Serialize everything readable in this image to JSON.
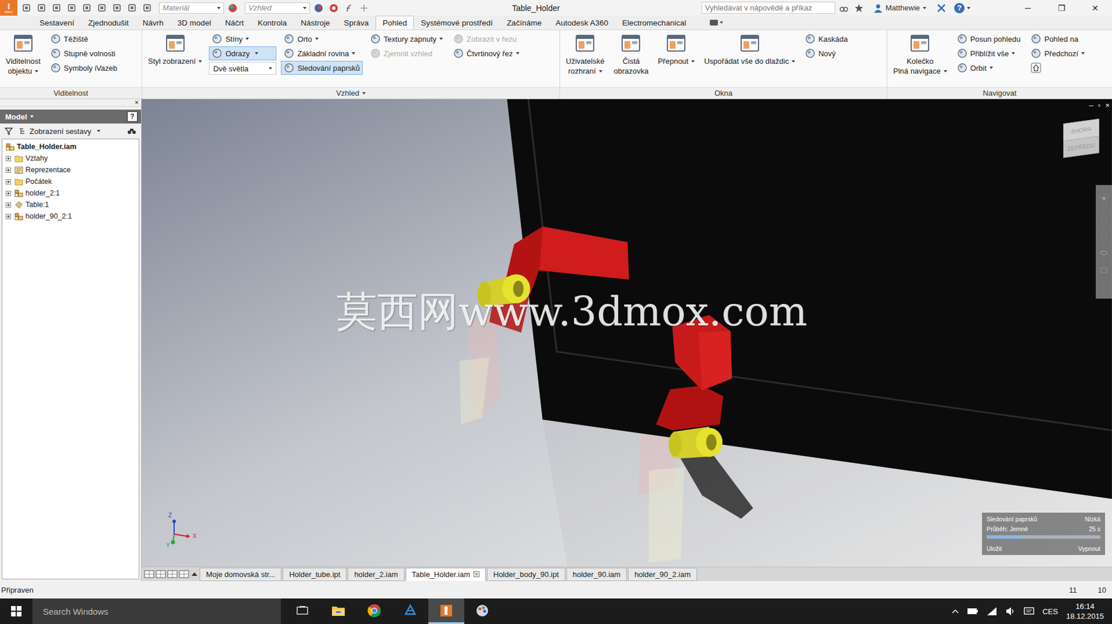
{
  "window": {
    "title": "Table_Holder",
    "controls": [
      "─",
      "❐",
      "✕"
    ]
  },
  "titlebar": {
    "logo": "I",
    "edition": "PRO",
    "material": "Materiál",
    "appearance": "Vzhled",
    "search_placeholder": "Vyhledávat v nápovědě a příkaz",
    "user": "Matthewie",
    "help": "?"
  },
  "ribbon": {
    "tabs": [
      {
        "label": "Sestavení",
        "selected": false
      },
      {
        "label": "Zjednodušit",
        "selected": false
      },
      {
        "label": "Návrh",
        "selected": false
      },
      {
        "label": "3D model",
        "selected": false
      },
      {
        "label": "Náčrt",
        "selected": false
      },
      {
        "label": "Kontrola",
        "selected": false
      },
      {
        "label": "Nástroje",
        "selected": false
      },
      {
        "label": "Správa",
        "selected": false
      },
      {
        "label": "Pohled",
        "selected": true
      },
      {
        "label": "Systémové prostředí",
        "selected": false
      },
      {
        "label": "Začínáme",
        "selected": false
      },
      {
        "label": "Autodesk A360",
        "selected": false
      },
      {
        "label": "Electromechanical",
        "selected": false
      }
    ],
    "groups": [
      {
        "label": "Viditelnost",
        "menu": false,
        "columns": [
          [
            {
              "kind": "large",
              "lines": [
                "Viditelnost",
                "objektu"
              ],
              "menu": true,
              "selected": false,
              "disabled": false
            }
          ],
          [
            {
              "kind": "small",
              "label": "Těžiště",
              "menu": false,
              "selected": false,
              "disabled": false
            },
            {
              "kind": "small",
              "label": "Stupně volnosti",
              "menu": false,
              "selected": false,
              "disabled": false
            },
            {
              "kind": "small",
              "label": "Symboly iVazeb",
              "menu": false,
              "selected": false,
              "disabled": false
            }
          ]
        ]
      },
      {
        "label": "Vzhled",
        "menu": true,
        "columns": [
          [
            {
              "kind": "large",
              "lines": [
                "Styl zobrazení"
              ],
              "menu": true,
              "selected": false,
              "disabled": false
            }
          ],
          [
            {
              "kind": "small",
              "label": "Stíny",
              "menu": true,
              "selected": false,
              "disabled": false
            },
            {
              "kind": "small",
              "label": "Odrazy",
              "menu": true,
              "selected": true,
              "disabled": false
            },
            {
              "kind": "select",
              "label": "Dvě světla",
              "menu": true,
              "selected": false,
              "disabled": false
            }
          ],
          [
            {
              "kind": "small",
              "label": "Orto",
              "menu": true,
              "selected": false,
              "disabled": false
            },
            {
              "kind": "small",
              "label": "Základní rovina",
              "menu": true,
              "selected": false,
              "disabled": false
            },
            {
              "kind": "small",
              "label": "Sledování paprsků",
              "menu": false,
              "selected": true,
              "disabled": false
            }
          ],
          [
            {
              "kind": "small",
              "label": "Textury zapnuty",
              "menu": true,
              "selected": false,
              "disabled": false
            },
            {
              "kind": "small",
              "label": "Zjemnit vzhled",
              "menu": false,
              "selected": false,
              "disabled": true
            }
          ],
          [
            {
              "kind": "small",
              "label": "Zobrazit v řezu",
              "menu": false,
              "selected": false,
              "disabled": true
            },
            {
              "kind": "small",
              "label": "Čtvrtinový řez",
              "menu": true,
              "selected": false,
              "disabled": false
            }
          ]
        ]
      },
      {
        "label": "Okna",
        "menu": false,
        "columns": [
          [
            {
              "kind": "large",
              "lines": [
                "Uživatelské",
                "rozhraní"
              ],
              "menu": true,
              "selected": false,
              "disabled": false
            }
          ],
          [
            {
              "kind": "large",
              "lines": [
                "Čistá",
                "obrazovka"
              ],
              "menu": false,
              "selected": false,
              "disabled": false
            }
          ],
          [
            {
              "kind": "large",
              "lines": [
                "Přepnout"
              ],
              "menu": true,
              "selected": false,
              "disabled": false
            }
          ],
          [
            {
              "kind": "large",
              "lines": [
                "Uspořádat vše do dlaždic"
              ],
              "menu": true,
              "selected": false,
              "disabled": false
            }
          ],
          [
            {
              "kind": "small",
              "label": "Kaskáda",
              "menu": false,
              "selected": false,
              "disabled": false
            },
            {
              "kind": "small",
              "label": "Nový",
              "menu": false,
              "selected": false,
              "disabled": false
            }
          ]
        ]
      },
      {
        "label": "Navigovat",
        "menu": false,
        "columns": [
          [
            {
              "kind": "large",
              "lines": [
                "Kolečko",
                "Plná navigace"
              ],
              "menu": true,
              "selected": false,
              "disabled": false
            }
          ],
          [
            {
              "kind": "small",
              "label": "Posun pohledu",
              "menu": false,
              "selected": false,
              "disabled": false
            },
            {
              "kind": "small",
              "label": "Přiblížit vše",
              "menu": true,
              "selected": false,
              "disabled": false
            },
            {
              "kind": "small",
              "label": "Orbit",
              "menu": true,
              "selected": false,
              "disabled": false
            }
          ],
          [
            {
              "kind": "small",
              "label": "Pohled na",
              "menu": false,
              "selected": false,
              "disabled": false
            },
            {
              "kind": "small",
              "label": "Předchozí",
              "menu": true,
              "selected": false,
              "disabled": false
            },
            {
              "kind": "icon",
              "label": "",
              "menu": false,
              "selected": false,
              "disabled": false
            }
          ]
        ]
      }
    ]
  },
  "browser": {
    "close": "×",
    "header": "Model",
    "help": "?",
    "view_select": "Zobrazení sestavy",
    "tree": [
      {
        "label": "Table_Holder.iam",
        "kind": "assembly",
        "expandable": false,
        "expanded": true,
        "bold": true
      },
      {
        "label": "Vztahy",
        "kind": "folder",
        "expandable": true,
        "expanded": false,
        "bold": false
      },
      {
        "label": "Reprezentace",
        "kind": "representation",
        "expandable": true,
        "expanded": false,
        "bold": false
      },
      {
        "label": "Počátek",
        "kind": "folder",
        "expandable": true,
        "expanded": false,
        "bold": false
      },
      {
        "label": "holder_2:1",
        "kind": "assembly",
        "expandable": true,
        "expanded": false,
        "bold": false
      },
      {
        "label": "Table:1",
        "kind": "part",
        "expandable": true,
        "expanded": false,
        "bold": false
      },
      {
        "label": "holder_90_2:1",
        "kind": "assembly",
        "expandable": true,
        "expanded": false,
        "bold": false
      }
    ]
  },
  "viewport": {
    "watermark": "莫西网www.3dmox.com",
    "controls": [
      "–",
      "▫",
      "×"
    ],
    "viewcube": {
      "top": "SHORA",
      "front": "ZEPŘEDU"
    },
    "axes": [
      "X",
      "Y",
      "Z"
    ],
    "ray_tracing": {
      "title": "Sledování paprsků",
      "quality": "Nízká",
      "progress_label": "Průběh: Jemné",
      "time": "25 s",
      "level": 0.3,
      "save": "Uložit",
      "stop": "Vypnout"
    }
  },
  "doc_tabs": [
    {
      "label": "Moje domovská str...",
      "selected": false,
      "closable": false
    },
    {
      "label": "Holder_tube.ipt",
      "selected": false,
      "closable": false
    },
    {
      "label": "holder_2.iam",
      "selected": false,
      "closable": false
    },
    {
      "label": "Table_Holder.iam",
      "selected": true,
      "closable": true
    },
    {
      "label": "Holder_body_90.ipt",
      "selected": false,
      "closable": false
    },
    {
      "label": "holder_90.iam",
      "selected": false,
      "closable": false
    },
    {
      "label": "holder_90_2.iam",
      "selected": false,
      "closable": false
    }
  ],
  "status_bar": {
    "text": "Připraven",
    "values": [
      "11",
      "10"
    ]
  },
  "taskbar": {
    "search_placeholder": "Search Windows",
    "apps": [
      {
        "kind": "task-view",
        "selected": false
      },
      {
        "kind": "explorer",
        "selected": false
      },
      {
        "kind": "chrome",
        "selected": false
      },
      {
        "kind": "app-blue",
        "selected": false
      },
      {
        "kind": "inventor",
        "selected": true
      },
      {
        "kind": "app-paint",
        "selected": false
      }
    ],
    "language": "CES",
    "time": "16:14",
    "date": "18.12.2015"
  }
}
